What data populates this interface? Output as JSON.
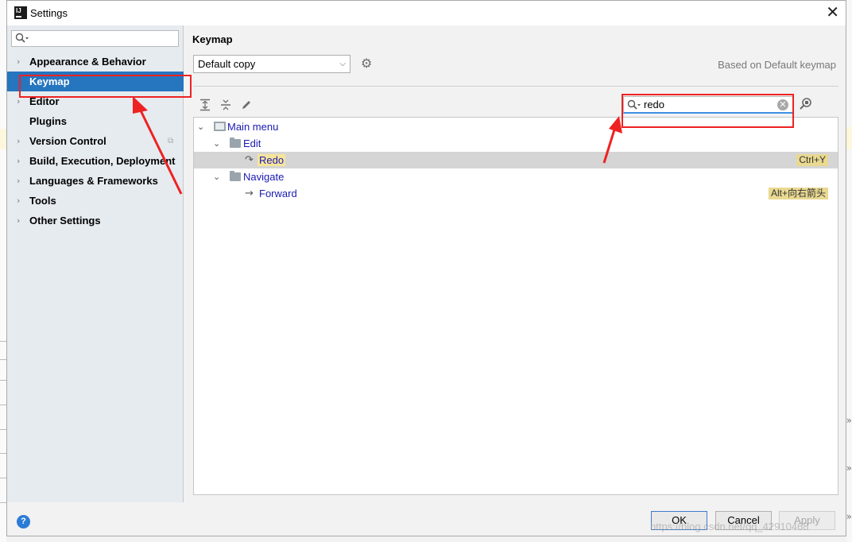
{
  "window": {
    "title": "Settings"
  },
  "sidebar": {
    "search_value": "",
    "items": [
      {
        "label": "Appearance & Behavior",
        "expandable": true
      },
      {
        "label": "Keymap",
        "expandable": false,
        "selected": true
      },
      {
        "label": "Editor",
        "expandable": true
      },
      {
        "label": "Plugins",
        "expandable": false
      },
      {
        "label": "Version Control",
        "expandable": true
      },
      {
        "label": "Build, Execution, Deployment",
        "expandable": true
      },
      {
        "label": "Languages & Frameworks",
        "expandable": true
      },
      {
        "label": "Tools",
        "expandable": true
      },
      {
        "label": "Other Settings",
        "expandable": true
      }
    ]
  },
  "keymap": {
    "title": "Keymap",
    "selected_keymap": "Default copy",
    "based_on": "Based on Default keymap",
    "search_value": "redo"
  },
  "tree": {
    "main_menu": "Main menu",
    "edit": "Edit",
    "redo": "Redo",
    "redo_shortcut": "Ctrl+Y",
    "navigate": "Navigate",
    "forward": "Forward",
    "forward_shortcut": "Alt+向右箭头"
  },
  "footer": {
    "help": "?",
    "ok": "OK",
    "cancel": "Cancel",
    "apply": "Apply"
  },
  "watermark": "https://blog.csdn.net/qq_42910468",
  "colors": {
    "selection": "#2675bf",
    "annotation": "#ee2222",
    "highlight": "#f6e59a"
  },
  "icons": [
    "app-icon",
    "close-icon",
    "search-icon",
    "gear-icon",
    "expand-all-icon",
    "collapse-all-icon",
    "edit-icon",
    "clear-icon",
    "find-by-shortcut-icon",
    "folder-icon",
    "redo-icon",
    "forward-arrow-icon",
    "help-icon"
  ]
}
